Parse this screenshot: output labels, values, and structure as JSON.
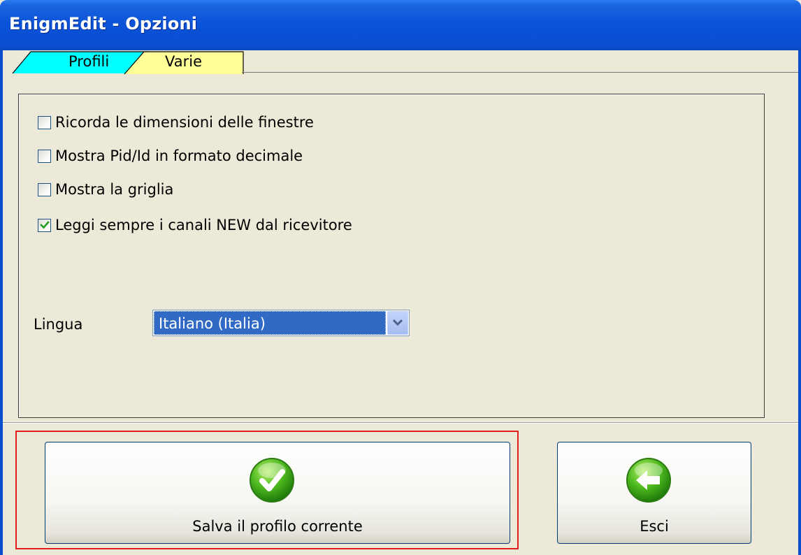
{
  "window": {
    "title": "EnigmEdit - Opzioni"
  },
  "tabs": [
    {
      "label": "Profili",
      "color": "#00ffff",
      "active": false
    },
    {
      "label": "Varie",
      "color": "#ffff99",
      "active": true
    }
  ],
  "options": [
    {
      "label": "Ricorda le dimensioni delle finestre",
      "checked": false
    },
    {
      "label": "Mostra Pid/Id in formato decimale",
      "checked": false
    },
    {
      "label": "Mostra la griglia",
      "checked": false
    },
    {
      "label": "Leggi sempre  i canali NEW dal ricevitore",
      "checked": true
    }
  ],
  "language": {
    "label": "Lingua",
    "selected": "Italiano (Italia)"
  },
  "buttons": {
    "save": {
      "label": "Salva il profilo corrente",
      "icon": "checkmark-icon"
    },
    "exit": {
      "label": "Esci",
      "icon": "back-arrow-icon"
    }
  },
  "colors": {
    "titlebar": "#0a4ed0",
    "highlight": "#e02020",
    "selection": "#316ac5",
    "icon_green": "#33a014"
  }
}
